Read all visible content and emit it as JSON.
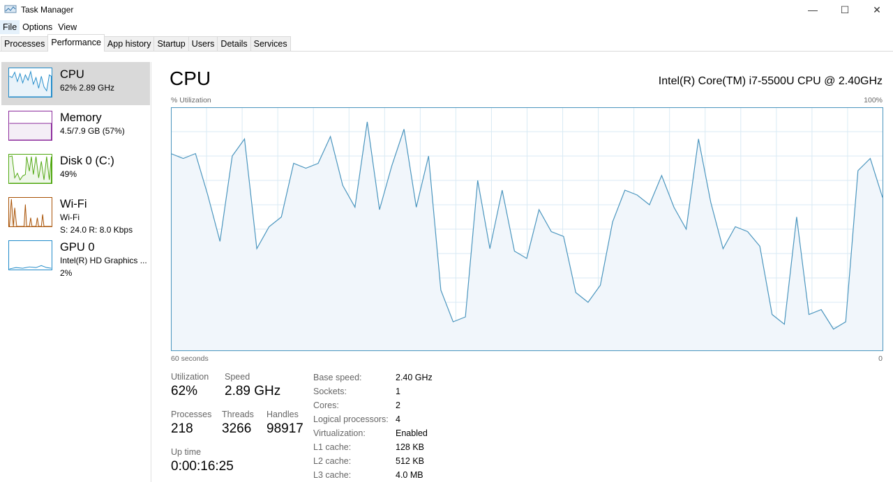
{
  "window": {
    "title": "Task Manager"
  },
  "menu": [
    "File",
    "Options",
    "View"
  ],
  "tabs": [
    "Processes",
    "Performance",
    "App history",
    "Startup",
    "Users",
    "Details",
    "Services"
  ],
  "sidebar": [
    {
      "name": "CPU",
      "line1": "62%  2.89 GHz",
      "color": "#1f8ac9"
    },
    {
      "name": "Memory",
      "line1": "4.5/7.9 GB (57%)",
      "color": "#8b2a9b"
    },
    {
      "name": "Disk 0 (C:)",
      "line1": "49%",
      "color": "#4da60c"
    },
    {
      "name": "Wi-Fi",
      "line1": "Wi-Fi",
      "line2": "S: 24.0  R: 8.0 Kbps",
      "color": "#a74f01"
    },
    {
      "name": "GPU 0",
      "line1": "Intel(R) HD Graphics ...",
      "line2": "2%",
      "color": "#1f8ac9"
    }
  ],
  "main": {
    "title": "CPU",
    "cpu_name": "Intel(R) Core(TM) i7-5500U CPU @ 2.40GHz",
    "y_label": "% Utilization",
    "y_max": "100%",
    "x_left": "60 seconds",
    "x_right": "0"
  },
  "stats": {
    "utilization": {
      "label": "Utilization",
      "value": "62%"
    },
    "speed": {
      "label": "Speed",
      "value": "2.89 GHz"
    },
    "processes": {
      "label": "Processes",
      "value": "218"
    },
    "threads": {
      "label": "Threads",
      "value": "3266"
    },
    "handles": {
      "label": "Handles",
      "value": "98917"
    },
    "uptime": {
      "label": "Up time",
      "value": "0:00:16:25"
    }
  },
  "details": [
    {
      "k": "Base speed:",
      "v": "2.40 GHz"
    },
    {
      "k": "Sockets:",
      "v": "1"
    },
    {
      "k": "Cores:",
      "v": "2"
    },
    {
      "k": "Logical processors:",
      "v": "4"
    },
    {
      "k": "Virtualization:",
      "v": "Enabled"
    },
    {
      "k": "L1 cache:",
      "v": "128 KB"
    },
    {
      "k": "L2 cache:",
      "v": "512 KB"
    },
    {
      "k": "L3 cache:",
      "v": "4.0 MB"
    }
  ],
  "chart_data": {
    "type": "area",
    "title": "CPU",
    "ylabel": "% Utilization",
    "xlabel": "60 seconds",
    "ylim": [
      0,
      100
    ],
    "grid": true,
    "values": [
      81,
      79,
      81,
      64,
      45,
      80,
      87,
      42,
      51,
      55,
      77,
      75,
      77,
      88,
      68,
      59,
      94,
      58,
      76,
      91,
      59,
      80,
      25,
      12,
      14,
      70,
      42,
      66,
      41,
      38,
      58,
      49,
      47,
      24,
      20,
      27,
      53,
      66,
      64,
      60,
      72,
      59,
      50,
      87,
      61,
      42,
      51,
      49,
      43,
      15,
      11,
      55,
      15,
      17,
      9,
      12,
      74,
      79,
      63
    ],
    "line_color": "#4a95be",
    "fill_color": "#f1f6fb",
    "grid_color": "#d9eaf4"
  }
}
